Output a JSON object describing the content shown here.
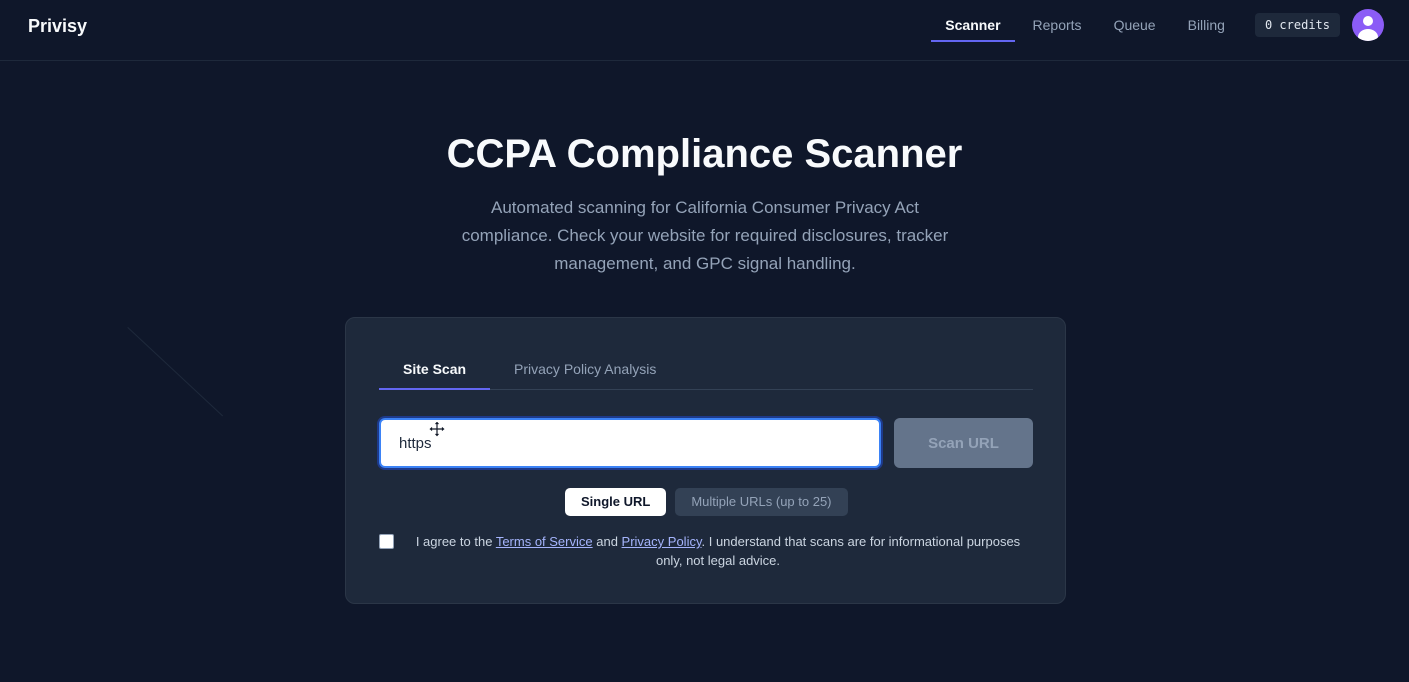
{
  "header": {
    "brand": "Privisy",
    "nav": [
      {
        "label": "Scanner",
        "active": true
      },
      {
        "label": "Reports",
        "active": false
      },
      {
        "label": "Queue",
        "active": false
      },
      {
        "label": "Billing",
        "active": false
      }
    ],
    "credits": "0 credits",
    "avatar_icon": "user-icon"
  },
  "hero": {
    "title": "CCPA Compliance Scanner",
    "subtitle": "Automated scanning for California Consumer Privacy Act compliance. Check your website for required disclosures, tracker management, and GPC signal handling."
  },
  "scanner": {
    "tabs": [
      {
        "label": "Site Scan",
        "active": true
      },
      {
        "label": "Privacy Policy Analysis",
        "active": false
      }
    ],
    "url_value": "https",
    "scan_button": "Scan URL",
    "modes": [
      {
        "label": "Single URL",
        "active": true
      },
      {
        "label": "Multiple URLs (up to 25)",
        "active": false
      }
    ],
    "agreement": {
      "prefix": "I agree to the ",
      "terms_link": "Terms of Service",
      "middle": " and ",
      "privacy_link": "Privacy Policy",
      "suffix": ". I understand that scans are for informational purposes only, not legal advice.",
      "checked": false
    }
  },
  "colors": {
    "background": "#0f172a",
    "card": "#1e293b",
    "accent": "#6366f1",
    "avatar": "#8b5cf6",
    "input_focus": "#3b82f6"
  },
  "icons": {
    "cursor": "move-cursor-icon"
  }
}
